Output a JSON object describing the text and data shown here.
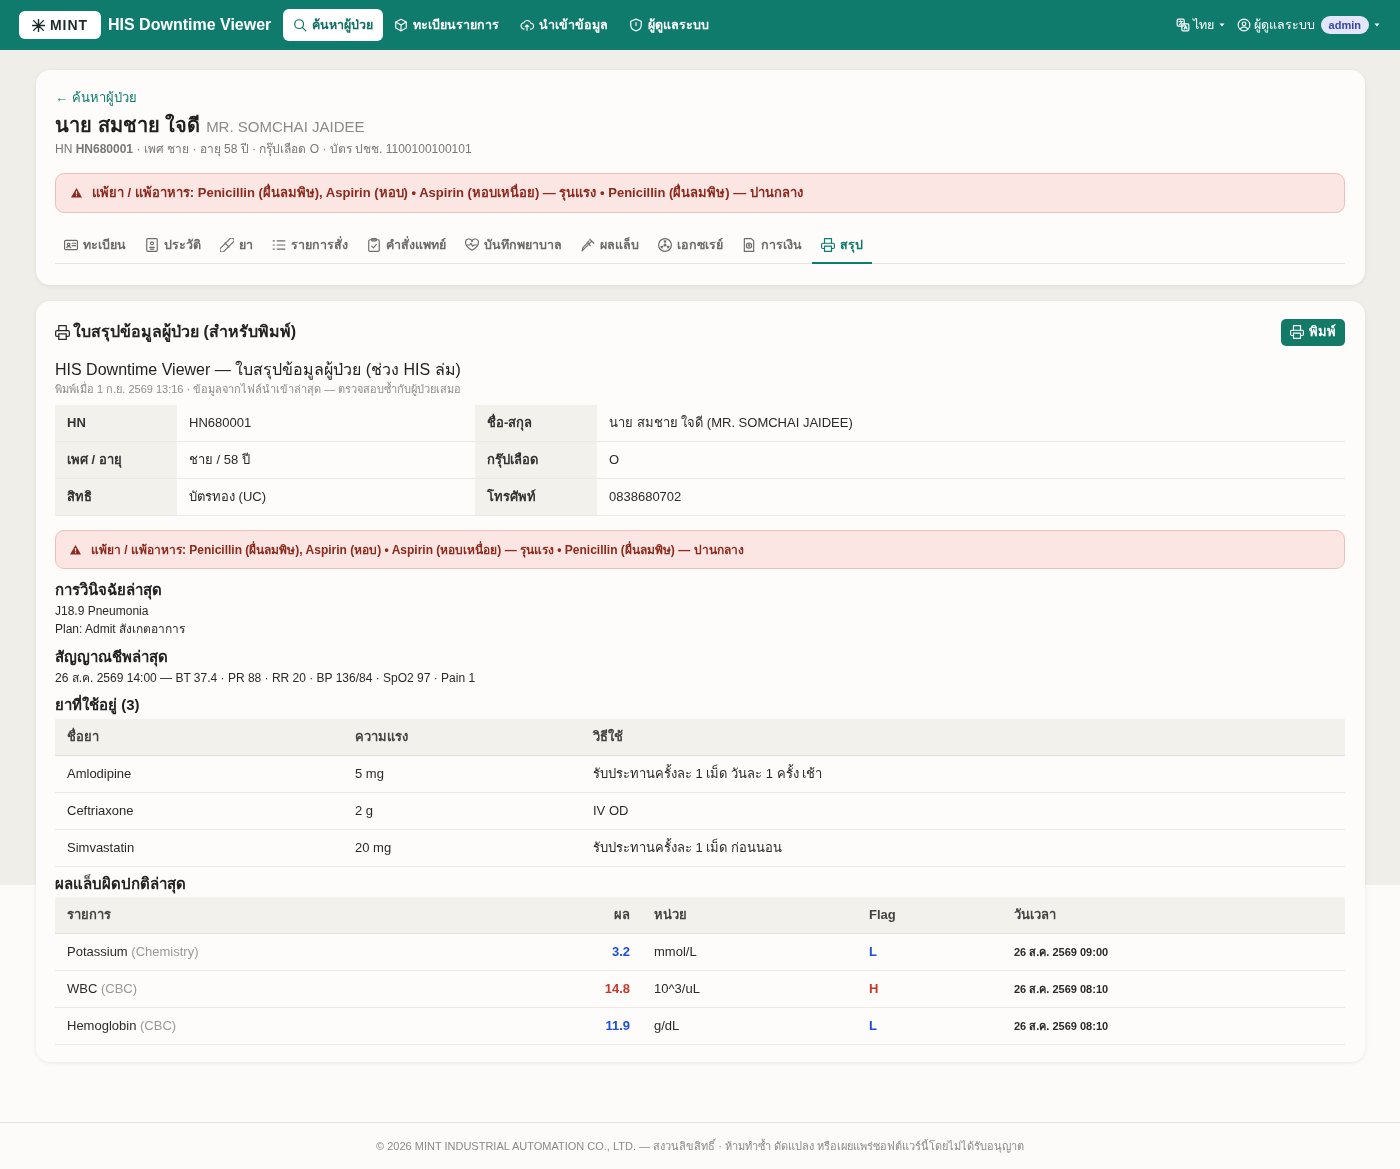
{
  "header": {
    "logo": "MINT",
    "title": "HIS Downtime Viewer",
    "nav": [
      {
        "label": "ค้นหาผู้ป่วย",
        "selected": true
      },
      {
        "label": "ทะเบียนรายการ",
        "selected": false
      },
      {
        "label": "นำเข้าข้อมูล",
        "selected": false
      },
      {
        "label": "ผู้ดูแลระบบ",
        "selected": false
      }
    ],
    "language": "ไทย",
    "user": "ผู้ดูแลระบบ",
    "role_badge": "admin"
  },
  "patient": {
    "back_link": "← ค้นหาผู้ป่วย",
    "name_th": "นาย สมชาย ใจดี",
    "name_en": "MR. SOMCHAI JAIDEE",
    "meta": "HN **HN680001** · เพศ ชาย · อายุ 58 ปี · กรุ๊ปเลือด O · บัตร ปชช. 1100100100101",
    "allergy_alert": "แพ้ยา / แพ้อาหาร: Penicillin (ผื่นลมพิษ), Aspirin (หอบ) • Aspirin (หอบเหนื่อย) — รุนแรง • Penicillin (ผื่นลมพิษ) — ปานกลาง"
  },
  "tabs": [
    {
      "label": "ทะเบียน",
      "selected": false
    },
    {
      "label": "ประวัติ",
      "selected": false
    },
    {
      "label": "ยา",
      "selected": false
    },
    {
      "label": "รายการสั่ง",
      "selected": false
    },
    {
      "label": "คำสั่งแพทย์",
      "selected": false
    },
    {
      "label": "บันทึกพยาบาล",
      "selected": false
    },
    {
      "label": "ผลแล็บ",
      "selected": false
    },
    {
      "label": "เอกซเรย์",
      "selected": false
    },
    {
      "label": "การเงิน",
      "selected": false
    },
    {
      "label": "สรุป",
      "selected": true
    }
  ],
  "summary": {
    "title": "ใบสรุปข้อมูลผู้ป่วย (สำหรับพิมพ์)",
    "print_button": "พิมพ์",
    "doc_title": "HIS Downtime Viewer — ใบสรุปข้อมูลผู้ป่วย (ช่วง HIS ล่ม)",
    "doc_subtitle": "พิมพ์เมื่อ 1 ก.ย. 2569 13:16 · ข้อมูลจากไฟล์นำเข้าล่าสุด — ตรวจสอบซ้ำกับผู้ป่วยเสมอ",
    "info_rows": [
      [
        {
          "label": "HN",
          "value": "HN680001"
        },
        {
          "label": "ชื่อ-สกุล",
          "value": "นาย สมชาย ใจดี (MR. SOMCHAI JAIDEE)"
        }
      ],
      [
        {
          "label": "เพศ / อายุ",
          "value": "ชาย / 58 ปี"
        },
        {
          "label": "กรุ๊ปเลือด",
          "value": "O"
        }
      ],
      [
        {
          "label": "สิทธิ",
          "value": "บัตรทอง (UC)"
        },
        {
          "label": "โทรศัพท์",
          "value": "0838680702"
        }
      ]
    ],
    "allergy_alert": "แพ้ยา / แพ้อาหาร: Penicillin (ผื่นลมพิษ), Aspirin (หอบ) • Aspirin (หอบเหนื่อย) — รุนแรง • Penicillin (ผื่นลมพิษ) — ปานกลาง",
    "diagnosis": {
      "heading": "การวินิจฉัยล่าสุด",
      "lines": [
        "J18.9 Pneumonia",
        "Plan: Admit สังเกตอาการ"
      ]
    },
    "vitals": {
      "heading": "สัญญาณชีพล่าสุด",
      "line": "26 ส.ค. 2569 14:00 — BT 37.4 · PR 88 · RR 20 · BP 136/84 · SpO2 97 · Pain 1"
    },
    "medications": {
      "heading": "ยาที่ใช้อยู่ (3)",
      "columns": [
        "ชื่อยา",
        "ความแรง",
        "วิธีใช้"
      ],
      "rows": [
        [
          "Amlodipine",
          "5 mg",
          "รับประทานครั้งละ 1 เม็ด วันละ 1 ครั้ง เช้า"
        ],
        [
          "Ceftriaxone",
          "2 g",
          "IV OD"
        ],
        [
          "Simvastatin",
          "20 mg",
          "รับประทานครั้งละ 1 เม็ด ก่อนนอน"
        ]
      ]
    },
    "labs": {
      "heading": "ผลแล็บผิดปกติล่าสุด",
      "columns": [
        "รายการ",
        "ผล",
        "หน่วย",
        "Flag",
        "วันเวลา"
      ],
      "rows": [
        {
          "test": "Potassium",
          "group": "(Chemistry)",
          "result": "3.2",
          "unit": "mmol/L",
          "flag": "L",
          "kind": "low",
          "datetime": "26 ส.ค. 2569 09:00"
        },
        {
          "test": "WBC",
          "group": "(CBC)",
          "result": "14.8",
          "unit": "10^3/uL",
          "flag": "H",
          "kind": "high",
          "datetime": "26 ส.ค. 2569 08:10"
        },
        {
          "test": "Hemoglobin",
          "group": "(CBC)",
          "result": "11.9",
          "unit": "g/dL",
          "flag": "L",
          "kind": "low",
          "datetime": "26 ส.ค. 2569 08:10"
        }
      ]
    }
  },
  "footer": "© 2026 MINT INDUSTRIAL AUTOMATION CO., LTD. — สงวนลิขสิทธิ์ · ห้ามทำซ้ำ ดัดแปลง หรือเผยแพร่ซอฟต์แวร์นี้โดยไม่ได้รับอนุญาต"
}
